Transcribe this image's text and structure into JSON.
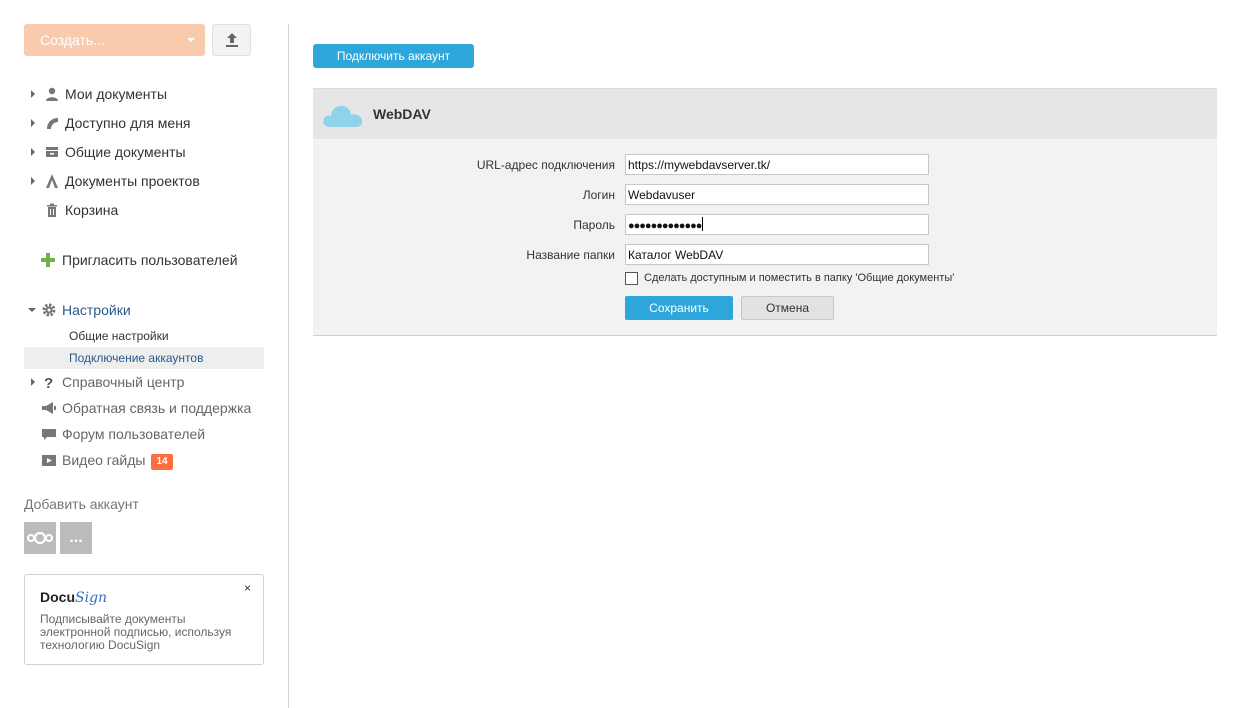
{
  "sidebar": {
    "create_label": "Создать...",
    "nav": [
      {
        "label": "Мои документы",
        "icon": "user-icon"
      },
      {
        "label": "Доступно для меня",
        "icon": "shared-icon"
      },
      {
        "label": "Общие документы",
        "icon": "common-docs-icon"
      },
      {
        "label": "Документы проектов",
        "icon": "projects-icon"
      },
      {
        "label": "Корзина",
        "icon": "trash-icon"
      }
    ],
    "invite_label": "Пригласить пользователей",
    "settings": {
      "label": "Настройки",
      "items": [
        "Общие настройки",
        "Подключение аккаунтов"
      ]
    },
    "help": [
      {
        "label": "Справочный центр",
        "icon": "help-icon"
      },
      {
        "label": "Обратная связь и поддержка",
        "icon": "megaphone-icon"
      },
      {
        "label": "Форум пользователей",
        "icon": "forum-icon"
      },
      {
        "label": "Видео гайды",
        "icon": "video-icon",
        "badge": "14"
      }
    ],
    "add_account": {
      "title": "Добавить аккаунт",
      "more_label": "..."
    },
    "docusign": {
      "close": "×",
      "logo_docu": "Docu",
      "logo_sign": "Sign",
      "text": "Подписывайте документы электронной подписью, используя технологию DocuSign"
    }
  },
  "main": {
    "connect_button": "Подключить аккаунт",
    "provider": {
      "name": "WebDAV",
      "icon": "cloud-icon"
    },
    "form": {
      "url_label": "URL-адрес подключения",
      "url_value": "https://mywebdavserver.tk/",
      "login_label": "Логин",
      "login_value": "Webdavuser",
      "password_label": "Пароль",
      "password_masked": "●●●●●●●●●●●●●",
      "folder_label": "Название папки",
      "folder_value": "Каталог WebDAV",
      "share_checkbox_label": "Сделать доступным и поместить в папку 'Общие документы'",
      "share_checked": false,
      "save_button": "Сохранить",
      "cancel_button": "Отмена"
    }
  },
  "colors": {
    "accent": "#2da7db",
    "create_button": "#f8cbad",
    "badge": "#ff6f3d",
    "settings_link": "#2a5a8a"
  }
}
